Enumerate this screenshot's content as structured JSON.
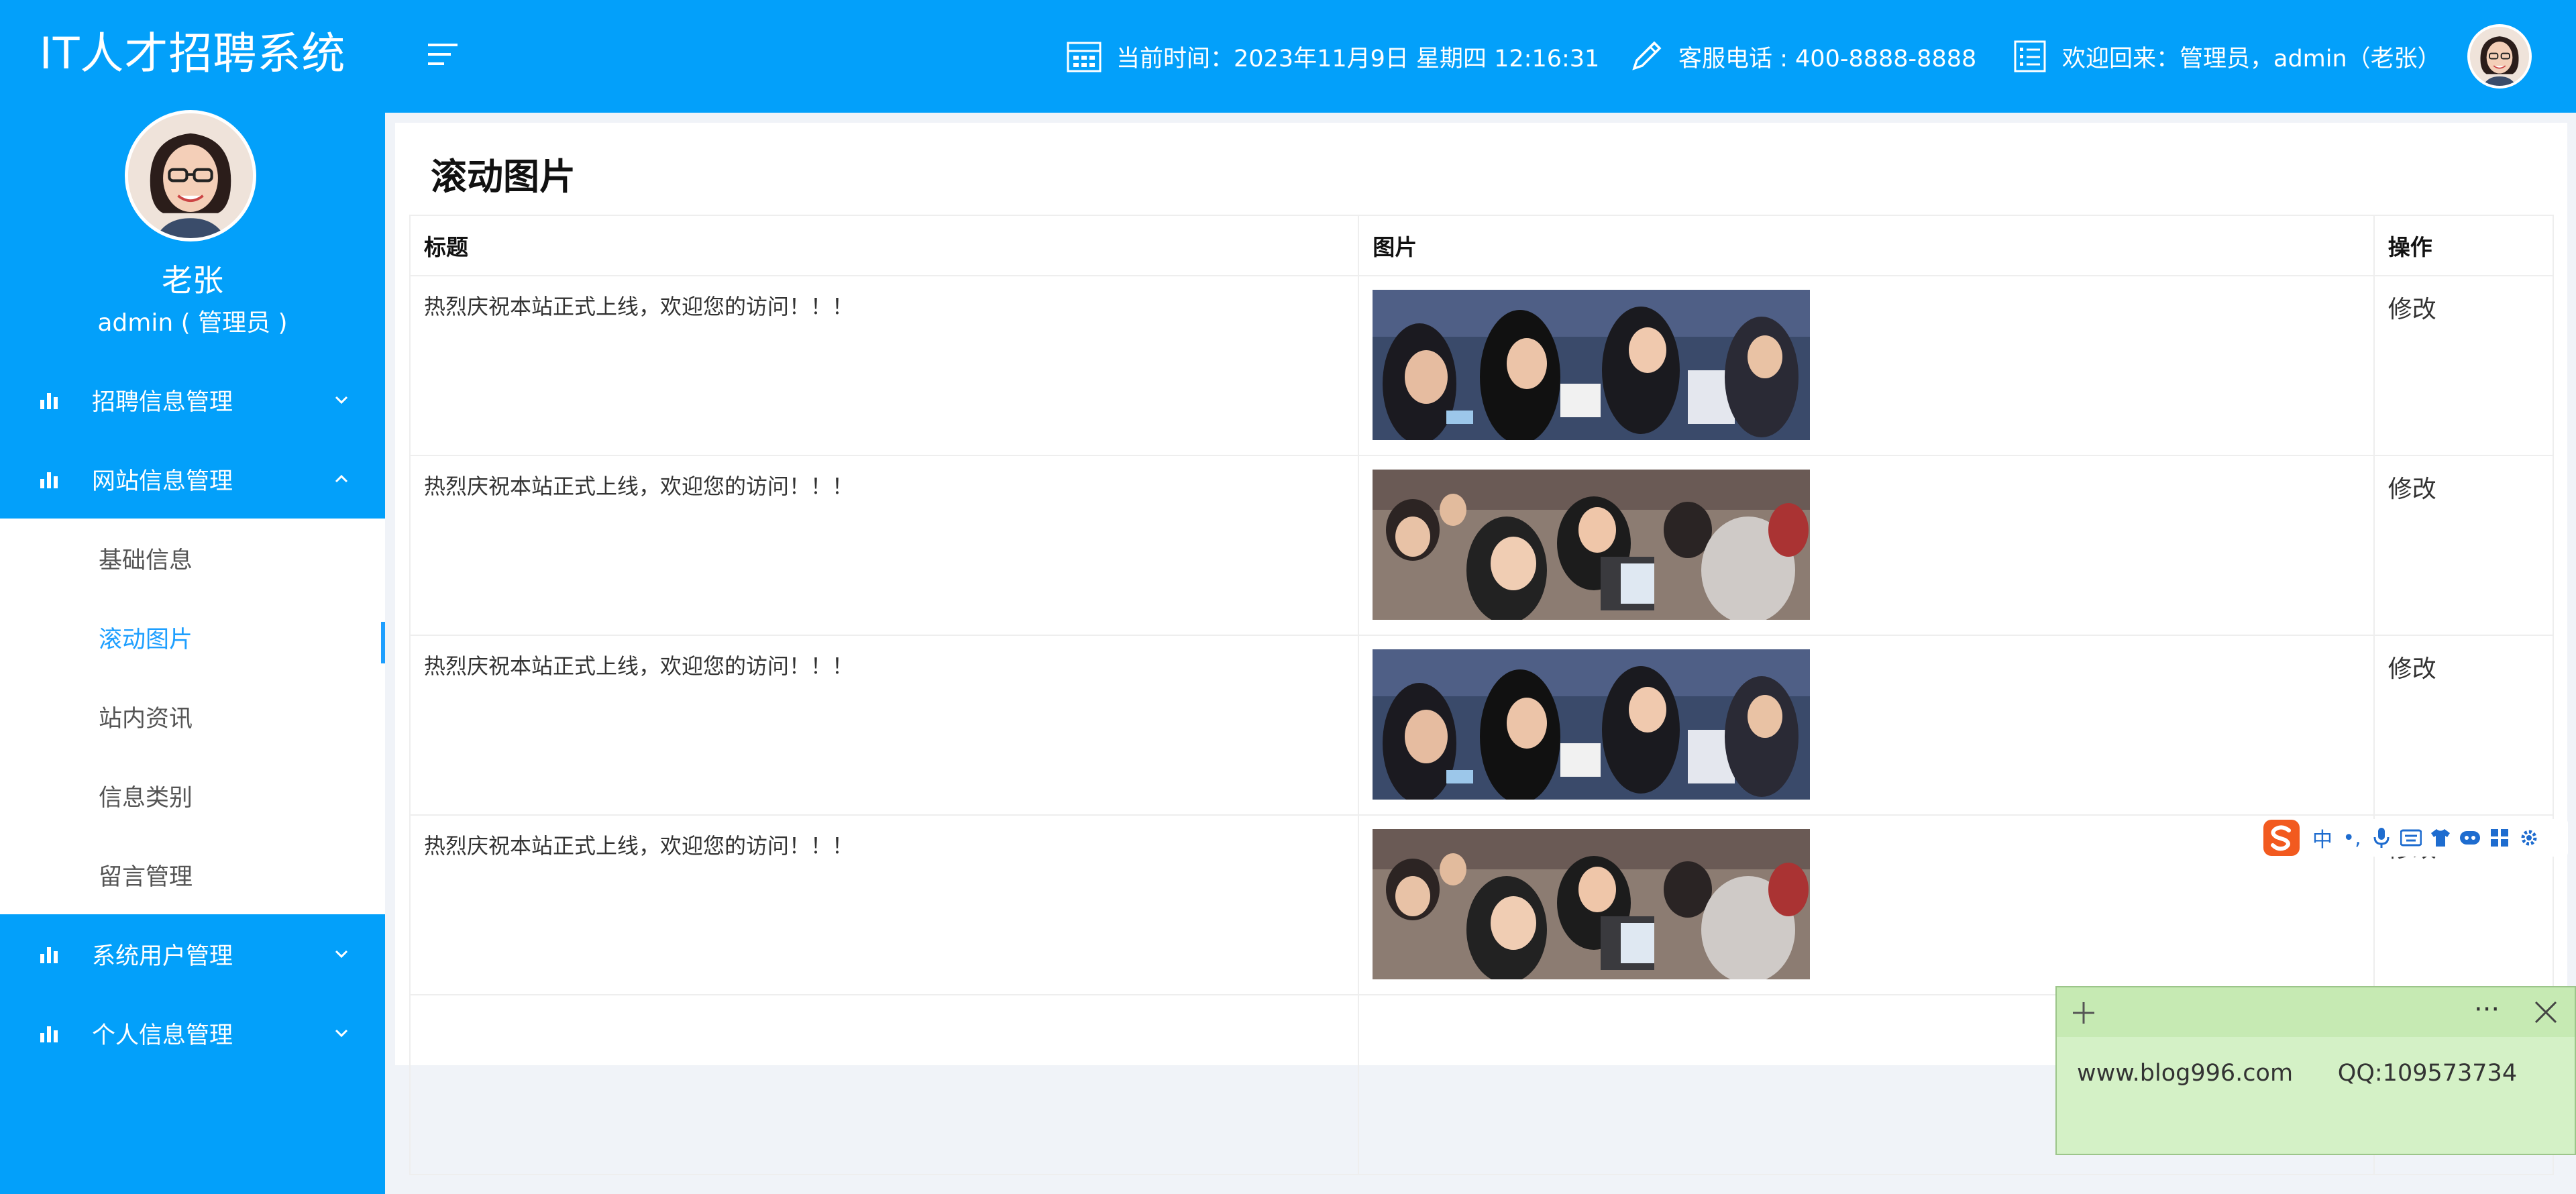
{
  "app": {
    "title": "IT人才招聘系统"
  },
  "user": {
    "name": "老张",
    "role": "admin ( 管理员 )"
  },
  "sidebar": {
    "items": [
      {
        "label": "招聘信息管理",
        "expanded": false
      },
      {
        "label": "网站信息管理",
        "expanded": true,
        "children": [
          "基础信息",
          "滚动图片",
          "站内资讯",
          "信息类别",
          "留言管理"
        ],
        "active_child": "滚动图片"
      },
      {
        "label": "系统用户管理",
        "expanded": false
      },
      {
        "label": "个人信息管理",
        "expanded": false
      }
    ]
  },
  "header": {
    "time_text": "当前时间：2023年11月9日 星期四 12:16:31",
    "phone_text": "客服电话 : 400-8888-8888",
    "welcome_text": "欢迎回来：管理员，admin（老张）"
  },
  "page": {
    "title": "滚动图片",
    "columns": [
      "标题",
      "图片",
      "操作"
    ],
    "rows": [
      {
        "title": "热烈庆祝本站正式上线，欢迎您的访问！！！",
        "image": "crowd-photo-1",
        "action": "修改"
      },
      {
        "title": "热烈庆祝本站正式上线，欢迎您的访问！！！",
        "image": "crowd-photo-2",
        "action": "修改"
      },
      {
        "title": "热烈庆祝本站正式上线，欢迎您的访问！！！",
        "image": "crowd-photo-1",
        "action": "修改"
      },
      {
        "title": "热烈庆祝本站正式上线，欢迎您的访问！！！",
        "image": "crowd-photo-2",
        "action": "修改"
      }
    ]
  },
  "ime_toolbar": {
    "mode": "中",
    "punct": "•,"
  },
  "sticky_note": {
    "text": "www.blog996.com      QQ:109573734",
    "more": "···"
  },
  "colors": {
    "brand": "#03a0fa",
    "accent": "#1e9fff",
    "note_bg": "#d4f1c6"
  }
}
